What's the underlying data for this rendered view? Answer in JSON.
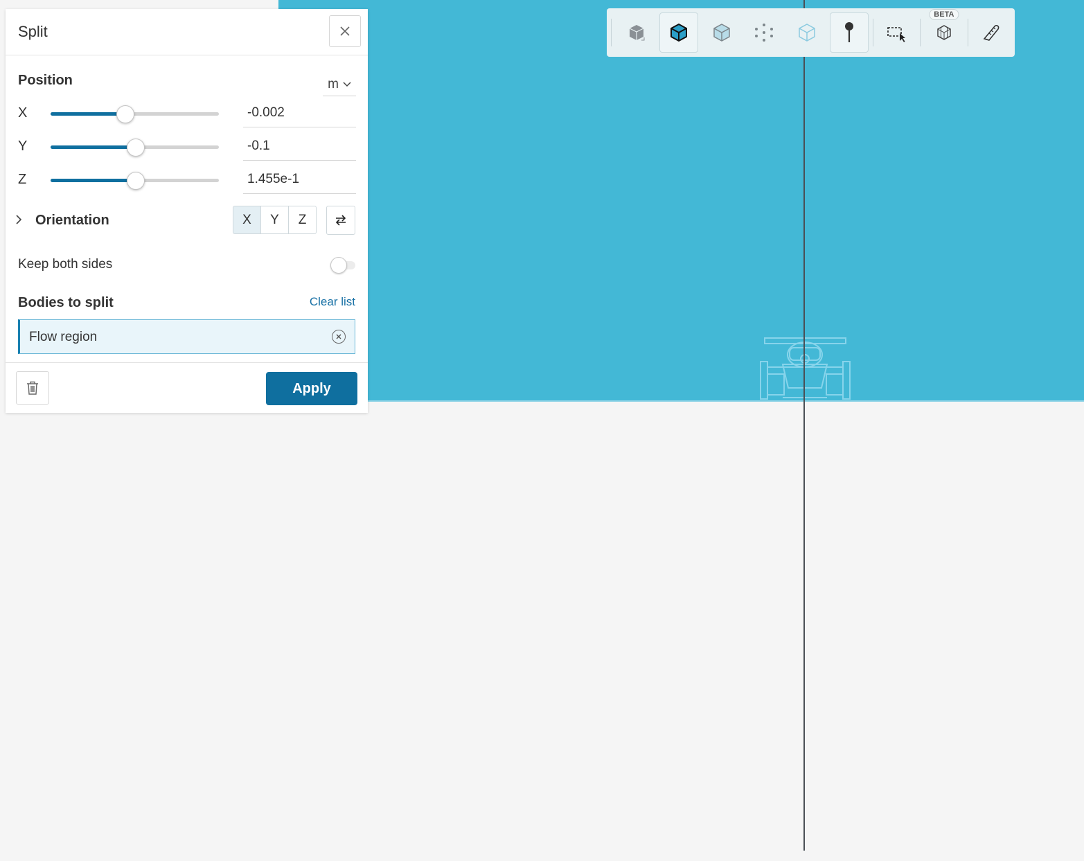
{
  "panel": {
    "title": "Split",
    "position": {
      "title": "Position",
      "unit": "m",
      "axes": [
        {
          "label": "X",
          "value": "-0.002",
          "slider_fraction": 0.44
        },
        {
          "label": "Y",
          "value": "-0.1",
          "slider_fraction": 0.5
        },
        {
          "label": "Z",
          "value": "1.455e-1",
          "slider_fraction": 0.5
        }
      ]
    },
    "orientation": {
      "title": "Orientation",
      "options": [
        "X",
        "Y",
        "Z"
      ],
      "selected": "X"
    },
    "keep_both_sides": {
      "label": "Keep both sides",
      "enabled": false
    },
    "bodies": {
      "title": "Bodies to split",
      "clear_label": "Clear list",
      "items": [
        "Flow region"
      ]
    },
    "apply_label": "Apply"
  },
  "toolbar": {
    "beta_label": "BETA",
    "buttons": [
      {
        "name": "solid-view-icon"
      },
      {
        "name": "solid-edges-view-icon"
      },
      {
        "name": "transparent-view-icon"
      },
      {
        "name": "points-view-icon"
      },
      {
        "name": "wireframe-view-icon"
      },
      {
        "name": "pin-icon"
      },
      {
        "name": "box-select-icon"
      },
      {
        "name": "mesh-select-icon"
      },
      {
        "name": "measure-icon"
      }
    ]
  },
  "colors": {
    "accent": "#0f6f9f",
    "viewport_domain": "#43b8d6",
    "background": "#f5f5f5"
  }
}
